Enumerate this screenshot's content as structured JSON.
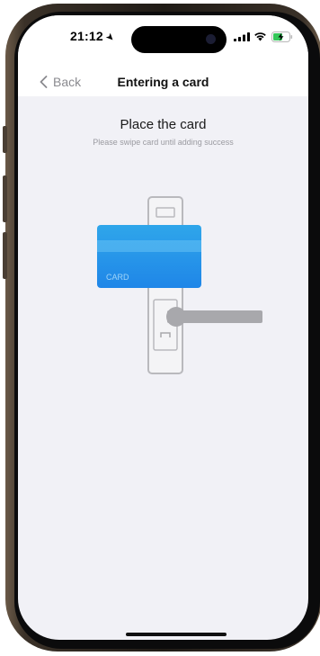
{
  "status_bar": {
    "time": "21:12"
  },
  "nav": {
    "back_label": "Back",
    "title": "Entering a card"
  },
  "content": {
    "title": "Place the card",
    "subtitle": "Please swipe card until adding success",
    "card_label": "CARD"
  },
  "colors": {
    "card_top": "#2fa6ea",
    "card_bottom": "#1f86e8",
    "lock_stroke": "#b9b9bd",
    "handle": "#a8a8ac",
    "battery_charge": "#34c759"
  },
  "icons": [
    "location-arrow-icon",
    "signal-icon",
    "wifi-icon",
    "battery-charging-icon",
    "chevron-left-icon"
  ]
}
